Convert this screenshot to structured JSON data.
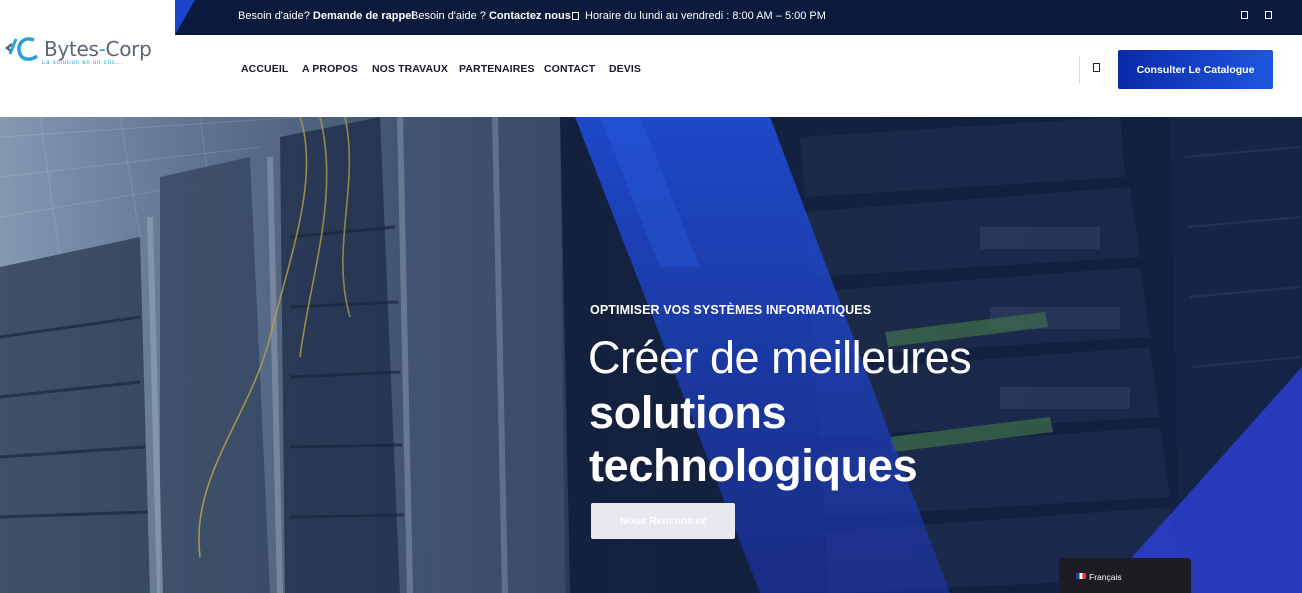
{
  "topbar": {
    "help1_prefix": "Besoin d'aide? ",
    "help1_link": "Demande de rappel",
    "help2_prefix": "Besoin d'aide ? ",
    "help2_link": "Contactez nous",
    "hours_icon": "clock-icon",
    "hours": "Horaire du lundi au vendredi : 8:00 AM – 5:00 PM",
    "social_icons": [
      "social-icon",
      "social-icon"
    ]
  },
  "logo": {
    "name_part1": "Bytes",
    "name_sep": "-",
    "name_part2": "Corp",
    "tagline": "La solution en un clic..."
  },
  "nav": {
    "items": [
      "ACCUEIL",
      "A PROPOS",
      "NOS TRAVAUX",
      "PARTENAIRES",
      "CONTACT",
      "DEVIS"
    ]
  },
  "header": {
    "search_icon": "search-icon",
    "cta_label": "Consulter Le Catalogue"
  },
  "hero": {
    "eyebrow": "OPTIMISER VOS SYSTÈMES INFORMATIQUES",
    "title_light": "Créer de meilleures",
    "title_bold_1": "solutions",
    "title_bold_2": "technologiques",
    "button_label": "Nous Rencontrez"
  },
  "language": {
    "flag_icon": "france-flag-icon",
    "label": "Français"
  },
  "colors": {
    "topbar_bg": "#0a1a3c",
    "accent_blue": "#1b44c8",
    "cta_blue": "#0a2aa8",
    "hero_overlay": "#0b1d4a"
  }
}
